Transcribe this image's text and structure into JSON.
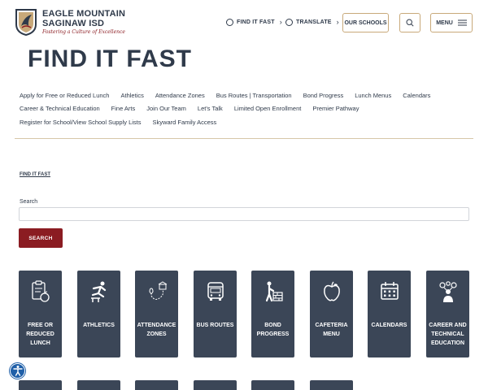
{
  "brand": {
    "line1": "EAGLE MOUNTAIN",
    "line2": "SAGINAW ISD",
    "tagline": "Fostering a Culture of Excellence"
  },
  "header": {
    "find_it_fast": "FIND IT FAST",
    "translate": "TRANSLATE",
    "our_schools": "OUR SCHOOLS",
    "menu": "MENU"
  },
  "page_title": "FIND IT FAST",
  "quick_links": [
    [
      "Apply for Free or Reduced Lunch",
      "Athletics",
      "Attendance Zones",
      "Bus Routes | Transportation",
      "Bond Progress",
      "Lunch Menus",
      "Calendars"
    ],
    [
      "Career & Technical Education",
      "Fine Arts",
      "Join Our Team",
      "Let's Talk",
      "Limited Open Enrollment",
      "Premier Pathway"
    ],
    [
      "Register for School/View School Supply Lists",
      "Skyward Family Access"
    ]
  ],
  "breadcrumb": "FIND IT FAST",
  "search": {
    "label": "Search",
    "value": "",
    "button": "SEARCH"
  },
  "tiles": [
    {
      "label": "FREE OR REDUCED LUNCH",
      "icon": "clipboard-apple-icon"
    },
    {
      "label": "ATHLETICS",
      "icon": "hurdler-icon"
    },
    {
      "label": "ATTENDANCE ZONES",
      "icon": "map-route-icon"
    },
    {
      "label": "BUS ROUTES",
      "icon": "bus-icon"
    },
    {
      "label": "BOND PROGRESS",
      "icon": "builder-bricks-icon"
    },
    {
      "label": "CAFETERIA MENU",
      "icon": "apple-icon"
    },
    {
      "label": "CALENDARS",
      "icon": "calendar-icon"
    },
    {
      "label": "CAREER AND TECHNICAL EDUCATION",
      "icon": "person-gears-icon"
    }
  ],
  "colors": {
    "navy": "#3b4657",
    "maroon": "#8b1c22",
    "gold": "#c8a97a",
    "text": "#2f3a4a"
  }
}
